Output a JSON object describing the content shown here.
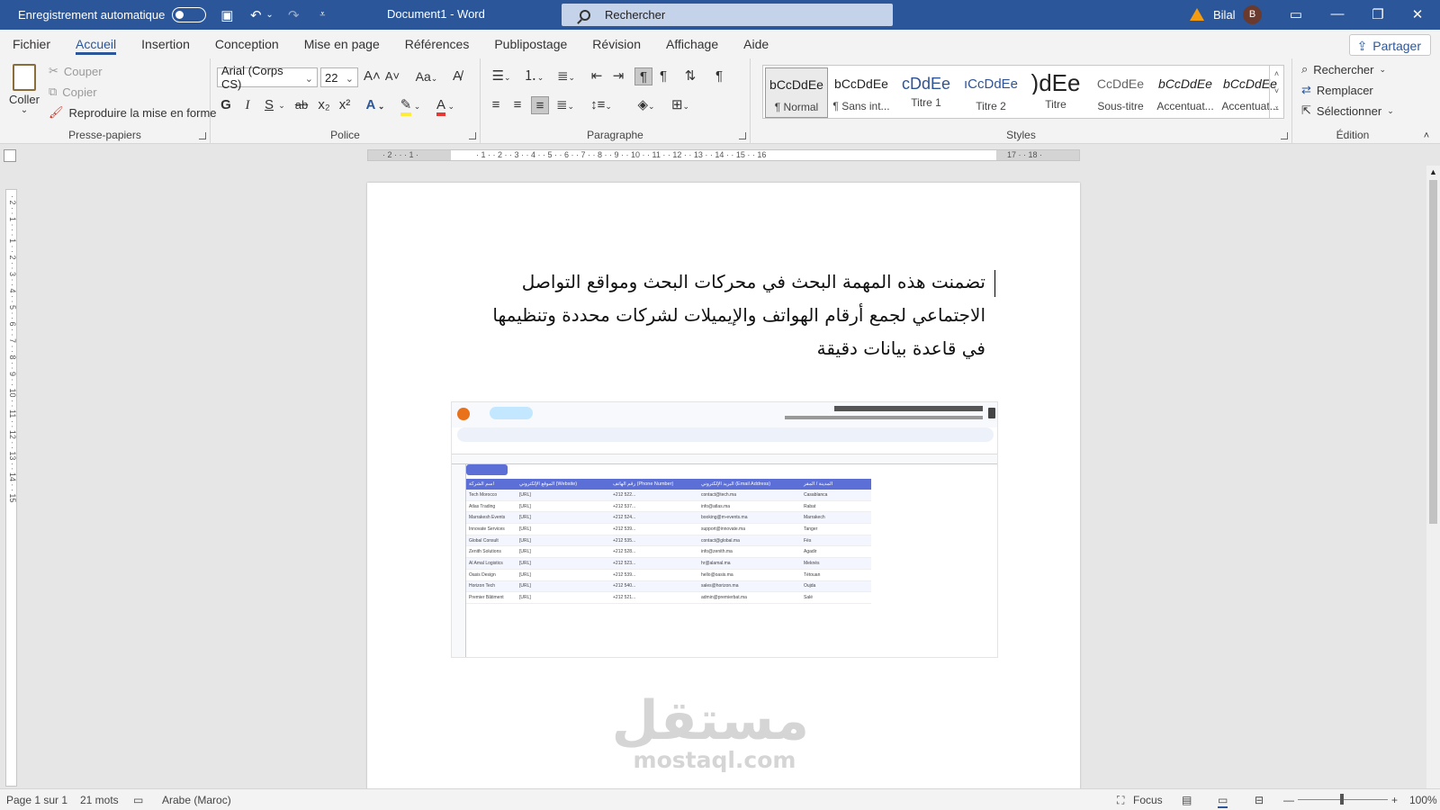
{
  "titlebar": {
    "autosave_label": "Enregistrement automatique",
    "document_title": "Document1  -  Word",
    "search_placeholder": "Rechercher",
    "user_name": "Bilal",
    "user_initial": "B"
  },
  "menu": {
    "items": [
      "Fichier",
      "Accueil",
      "Insertion",
      "Conception",
      "Mise en page",
      "Références",
      "Publipostage",
      "Révision",
      "Affichage",
      "Aide"
    ],
    "active_index": 1,
    "share_label": "Partager"
  },
  "ribbon": {
    "clipboard": {
      "paste": "Coller",
      "cut": "Couper",
      "copy": "Copier",
      "format_painter": "Reproduire la mise en forme",
      "group_label": "Presse-papiers"
    },
    "font": {
      "font_name": "Arial (Corps CS)",
      "font_size": "22",
      "case_button": "Aa",
      "bold": "G",
      "italic": "I",
      "underline": "S",
      "strike": "ab",
      "group_label": "Police"
    },
    "paragraph": {
      "group_label": "Paragraphe"
    },
    "styles": {
      "group_label": "Styles",
      "items": [
        {
          "preview": "bCcDdEe",
          "name": "¶ Normal"
        },
        {
          "preview": "bCcDdEe",
          "name": "¶ Sans int..."
        },
        {
          "preview": "cDdEe",
          "name": "Titre 1"
        },
        {
          "preview": "ıCcDdEe",
          "name": "Titre 2"
        },
        {
          "preview": ")dEe",
          "name": "Titre"
        },
        {
          "preview": "CcDdEe",
          "name": "Sous-titre"
        },
        {
          "preview": "bCcDdEe",
          "name": "Accentuat..."
        },
        {
          "preview": "bCcDdEe",
          "name": "Accentuat..."
        }
      ]
    },
    "editing": {
      "group_label": "Édition",
      "find": "Rechercher",
      "replace": "Remplacer",
      "select": "Sélectionner"
    }
  },
  "document": {
    "paragraph": "تضمنت هذه المهمة البحث في محركات البحث ومواقع التواصل الاجتماعي لجمع أرقام الهواتف والإيميلات لشركات محددة وتنظيمها في قاعدة بيانات دقيقة",
    "embedded_sheet": {
      "columns": [
        "اسم الشركة",
        "الموقع الإلكتروني (Website)",
        "رقم الهاتف (Phone Number)",
        "البريد الإلكتروني (Email Address)",
        "المدينة / المقر"
      ],
      "rows": [
        [
          "Tech Morocco",
          "[URL]",
          "+212 522...",
          "contact@tech.ma",
          "Casablanca"
        ],
        [
          "Atlas Trading",
          "[URL]",
          "+212 537...",
          "info@atlas.ma",
          "Rabat"
        ],
        [
          "Marrakesh Events",
          "[URL]",
          "+212 524...",
          "booking@m-events.ma",
          "Marrakech"
        ],
        [
          "Innovate Services",
          "[URL]",
          "+212 539...",
          "support@innovate.ma",
          "Tanger"
        ],
        [
          "Global Consult",
          "[URL]",
          "+212 535...",
          "contact@global.ma",
          "Fès"
        ],
        [
          "Zenith Solutions",
          "[URL]",
          "+212 528...",
          "info@zenith.ma",
          "Agadir"
        ],
        [
          "Al Amal Logistics",
          "[URL]",
          "+212 523...",
          "hr@alamal.ma",
          "Meknès"
        ],
        [
          "Oasis Design",
          "[URL]",
          "+212 539...",
          "hello@oasis.ma",
          "Tétouan"
        ],
        [
          "Horizon Tech",
          "[URL]",
          "+212 540...",
          "sales@horizon.ma",
          "Oujda"
        ],
        [
          "Premier Bâtiment",
          "[URL]",
          "+212 521...",
          "admin@premierbat.ma",
          "Salé"
        ]
      ]
    },
    "watermark_ar": "مستقل",
    "watermark_latin": "mostaql.com"
  },
  "statusbar": {
    "page": "Page 1 sur 1",
    "words": "21 mots",
    "language": "Arabe (Maroc)",
    "focus": "Focus",
    "zoom": "100%"
  }
}
